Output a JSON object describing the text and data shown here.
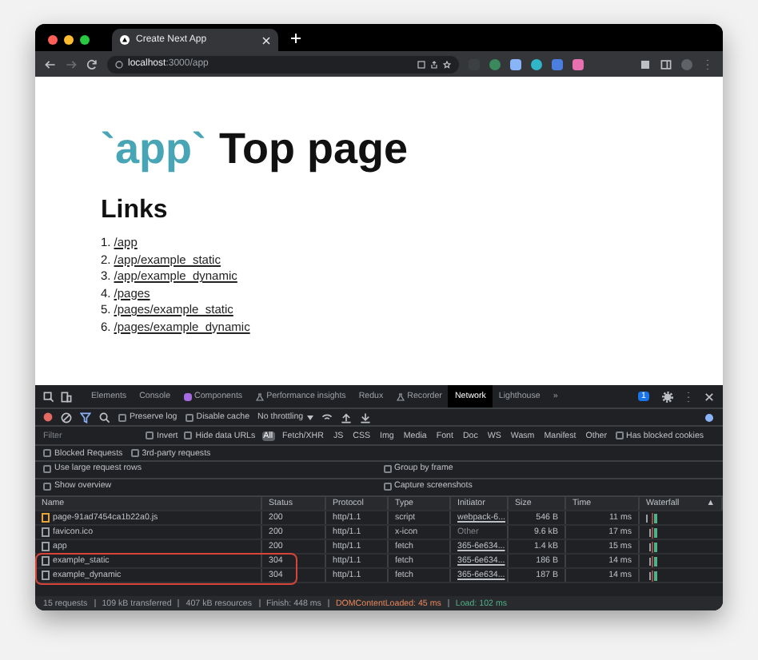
{
  "browser": {
    "tab_title": "Create Next App",
    "url_host": "localhost",
    "url_path": ":3000/app"
  },
  "page": {
    "heading_code": "`app`",
    "heading_text": "Top page",
    "subheading": "Links",
    "links": [
      {
        "number": "1.",
        "label": "/app"
      },
      {
        "number": "2.",
        "label": "/app/example_static"
      },
      {
        "number": "3.",
        "label": "/app/example_dynamic"
      },
      {
        "number": "4.",
        "label": "/pages"
      },
      {
        "number": "5.",
        "label": "/pages/example_static"
      },
      {
        "number": "6.",
        "label": "/pages/example_dynamic"
      }
    ]
  },
  "devtools": {
    "tabs": [
      {
        "label": "Elements",
        "selected": false,
        "kind": "plain"
      },
      {
        "label": "Console",
        "selected": false,
        "kind": "plain"
      },
      {
        "label": "Components",
        "selected": false,
        "kind": "react"
      },
      {
        "label": "Performance insights",
        "selected": false,
        "kind": "flask"
      },
      {
        "label": "Redux",
        "selected": false,
        "kind": "plain"
      },
      {
        "label": "Recorder",
        "selected": false,
        "kind": "flask"
      },
      {
        "label": "Network",
        "selected": true,
        "kind": "plain"
      },
      {
        "label": "Lighthouse",
        "selected": false,
        "kind": "plain"
      }
    ],
    "more": "»",
    "issues_badge": "1",
    "toolbar": {
      "preserve_log": {
        "label": "Preserve log",
        "checked": false
      },
      "disable_cache": {
        "label": "Disable cache",
        "checked": false
      },
      "throttling": "No throttling"
    },
    "filter": {
      "placeholder": "Filter",
      "invert": {
        "label": "Invert",
        "checked": false
      },
      "hide_data_urls": {
        "label": "Hide data URLs",
        "checked": false
      },
      "types": [
        {
          "label": "All",
          "selected": true
        },
        {
          "label": "Fetch/XHR",
          "selected": false
        },
        {
          "label": "JS",
          "selected": false
        },
        {
          "label": "CSS",
          "selected": false
        },
        {
          "label": "Img",
          "selected": false
        },
        {
          "label": "Media",
          "selected": false
        },
        {
          "label": "Font",
          "selected": false
        },
        {
          "label": "Doc",
          "selected": false
        },
        {
          "label": "WS",
          "selected": false
        },
        {
          "label": "Wasm",
          "selected": false
        },
        {
          "label": "Manifest",
          "selected": false
        },
        {
          "label": "Other",
          "selected": false
        }
      ],
      "has_blocked_cookies": {
        "label": "Has blocked cookies",
        "checked": false
      }
    },
    "request_filters": [
      {
        "label": "Blocked Requests",
        "checked": false
      },
      {
        "label": "3rd-party requests",
        "checked": false
      }
    ],
    "settings": [
      {
        "label": "Use large request rows",
        "checked": false
      },
      {
        "label": "Group by frame",
        "checked": false
      },
      {
        "label": "Show overview",
        "checked": false
      },
      {
        "label": "Capture screenshots",
        "checked": false
      }
    ],
    "columns": [
      "Name",
      "Status",
      "Protocol",
      "Type",
      "Initiator",
      "Size",
      "Time",
      "Waterfall"
    ],
    "sort_arrow": "▲",
    "rows": [
      {
        "kind": "script",
        "name": "page-91ad7454ca1b22a0.js",
        "status": "200",
        "protocol": "http/1.1",
        "type": "script",
        "initiator": "webpack-6...",
        "initiator_link": true,
        "size": "546 B",
        "time": "11 ms",
        "highlighted": false
      },
      {
        "kind": "file",
        "name": "favicon.ico",
        "status": "200",
        "protocol": "http/1.1",
        "type": "x-icon",
        "initiator": "Other",
        "initiator_link": false,
        "size": "9.6 kB",
        "time": "17 ms",
        "highlighted": false
      },
      {
        "kind": "file",
        "name": "app",
        "status": "200",
        "protocol": "http/1.1",
        "type": "fetch",
        "initiator": "365-6e634...",
        "initiator_link": true,
        "size": "1.4 kB",
        "time": "15 ms",
        "highlighted": false
      },
      {
        "kind": "file",
        "name": "example_static",
        "status": "304",
        "protocol": "http/1.1",
        "type": "fetch",
        "initiator": "365-6e634...",
        "initiator_link": true,
        "size": "186 B",
        "time": "14 ms",
        "highlighted": true
      },
      {
        "kind": "file",
        "name": "example_dynamic",
        "status": "304",
        "protocol": "http/1.1",
        "type": "fetch",
        "initiator": "365-6e634...",
        "initiator_link": true,
        "size": "187 B",
        "time": "14 ms",
        "highlighted": true
      }
    ],
    "summary": [
      {
        "text": "15 requests",
        "color": "#9aa0a6"
      },
      {
        "text": "109 kB transferred",
        "color": "#9aa0a6"
      },
      {
        "text": "407 kB resources",
        "color": "#9aa0a6"
      },
      {
        "text": "Finish: 448 ms",
        "color": "#9aa0a6"
      },
      {
        "text": "DOMContentLoaded: 45 ms",
        "color": "#e8875c"
      },
      {
        "text": "Load: 102 ms",
        "color": "#4fb287"
      }
    ]
  }
}
